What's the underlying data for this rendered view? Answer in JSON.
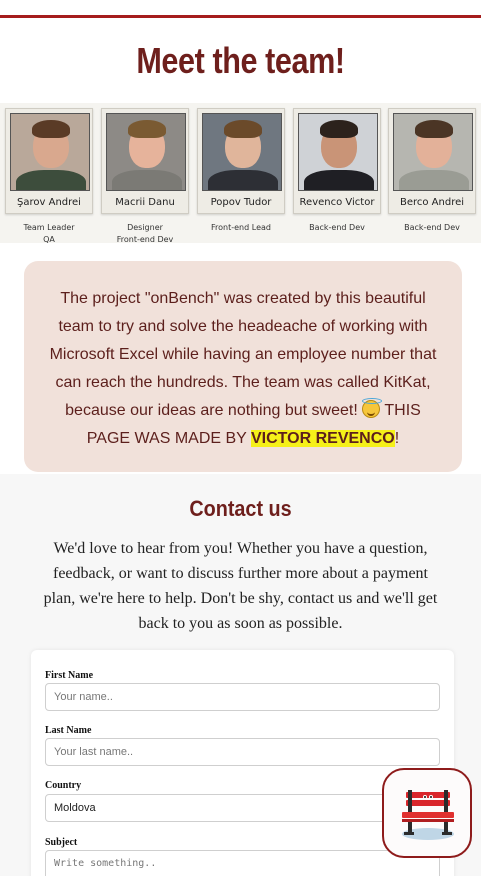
{
  "header": {
    "title": "Meet the team!"
  },
  "team": [
    {
      "name": "Şarov Andrei",
      "role": "Team Leader\nQA",
      "colors": {
        "bg": "#b9a89a",
        "skin": "#d9a88e",
        "hair": "#5a3b26",
        "shirt": "#3d4d3c"
      }
    },
    {
      "name": "Macrii Danu",
      "role": "Designer\nFront-end Dev",
      "colors": {
        "bg": "#8d8a86",
        "skin": "#e6b39b",
        "hair": "#7a5a32",
        "shirt": "#7b7a75"
      }
    },
    {
      "name": "Popov Tudor",
      "role": "Front-end Lead",
      "colors": {
        "bg": "#6f7780",
        "skin": "#e0b59b",
        "hair": "#6b4a2a",
        "shirt": "#2d2f35"
      }
    },
    {
      "name": "Revenco Victor",
      "role": "Back-end Dev",
      "colors": {
        "bg": "#cfd2d6",
        "skin": "#c99477",
        "hair": "#2c221c",
        "shirt": "#1f1f24"
      }
    },
    {
      "name": "Berco Andrei",
      "role": "Back-end Dev",
      "colors": {
        "bg": "#b6b6b0",
        "skin": "#e3b199",
        "hair": "#4b3525",
        "shirt": "#9a9c94"
      }
    }
  ],
  "about": {
    "text": "The project \"onBench\" was created by this beautiful team to try and solve the headeache of working with Microsoft Excel while having an employee number that can reach the hundreds. The team was called KitKat, because our ideas are nothing but sweet!",
    "emoji": "smiling-face-with-halo",
    "made_by_prefix": "THIS PAGE WAS MADE BY",
    "made_by_name": "VICTOR REVENCO",
    "made_by_suffix": "!"
  },
  "contact": {
    "title": "Contact us",
    "text": "We'd love to hear from you! Whether you have a question, feedback, or want to discuss further more about a payment plan, we're here to help. Don't be shy, contact us and we'll get back to you as soon as possible.",
    "fields": {
      "first_name": {
        "label": "First Name",
        "placeholder": "Your name.."
      },
      "last_name": {
        "label": "Last Name",
        "placeholder": "Your last name.."
      },
      "country": {
        "label": "Country",
        "value": "Moldova"
      },
      "subject": {
        "label": "Subject",
        "placeholder": "Write something.."
      }
    }
  },
  "chat_button": {
    "icon": "bench-icon"
  },
  "colors": {
    "accent": "#a51c1c",
    "title": "#6e1f1c",
    "about_bg": "#f1e1da",
    "highlight": "#f5f019"
  }
}
